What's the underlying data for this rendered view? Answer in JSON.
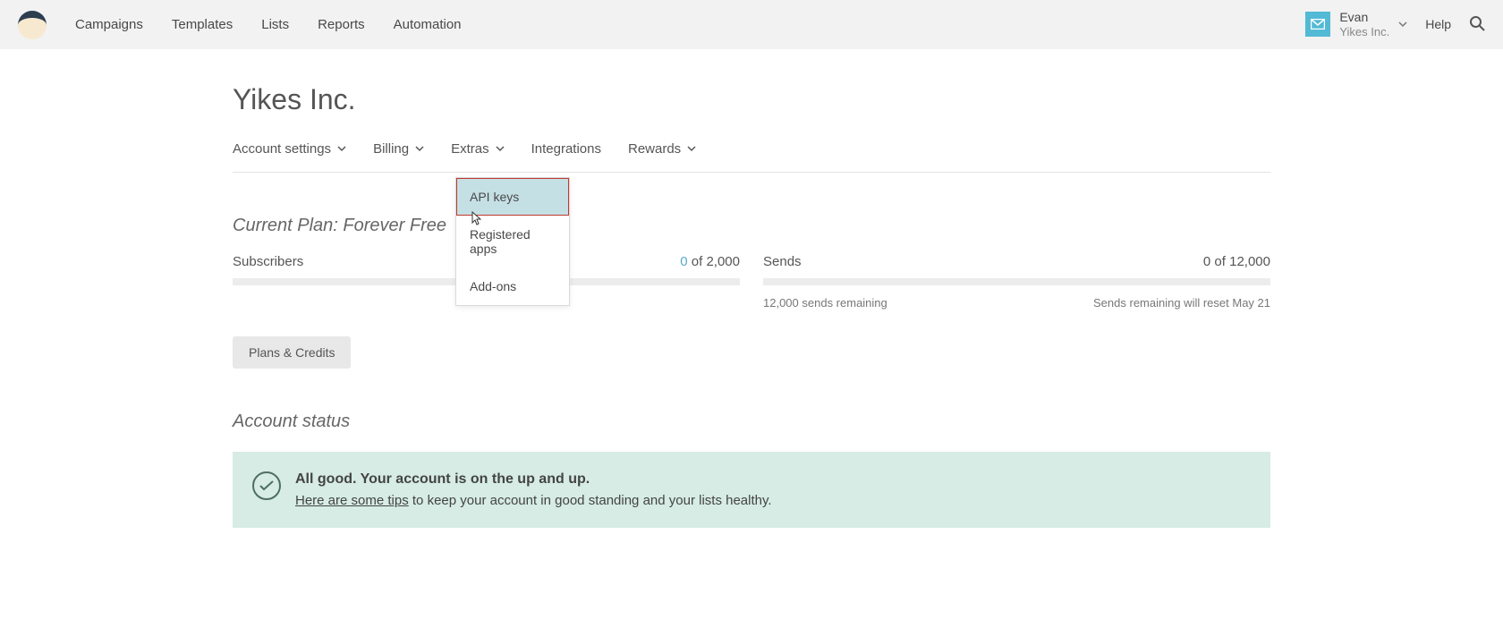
{
  "header": {
    "nav": [
      "Campaigns",
      "Templates",
      "Lists",
      "Reports",
      "Automation"
    ],
    "user_name": "Evan",
    "user_org": "Yikes Inc.",
    "help": "Help"
  },
  "page_title": "Yikes Inc.",
  "subnav": {
    "account_settings": "Account settings",
    "billing": "Billing",
    "extras": "Extras",
    "integrations": "Integrations",
    "rewards": "Rewards"
  },
  "dropdown": {
    "api_keys": "API keys",
    "registered_apps": "Registered apps",
    "addons": "Add-ons"
  },
  "plan": {
    "heading": "Current Plan: Forever Free",
    "subscribers_label": "Subscribers",
    "subscribers_count": "0",
    "subscribers_of": " of 2,000",
    "sends_label": "Sends",
    "sends_value": "0 of 12,000",
    "sends_remaining": "12,000 sends remaining",
    "sends_reset": "Sends remaining will reset May 21",
    "plans_button": "Plans & Credits"
  },
  "account_status": {
    "heading": "Account status",
    "title": "All good. Your account is on the up and up.",
    "tips_link": "Here are some tips",
    "rest": " to keep your account in good standing and your lists healthy."
  }
}
